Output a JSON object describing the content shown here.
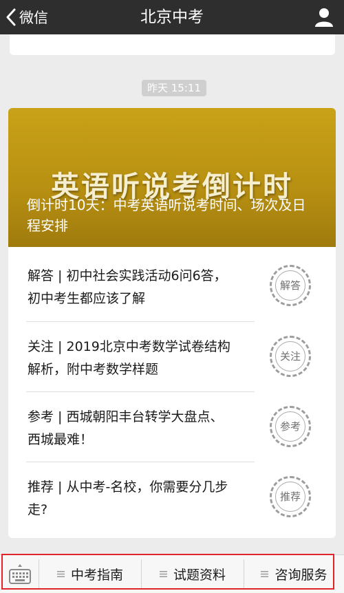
{
  "header": {
    "back_label": "微信",
    "title": "北京中考"
  },
  "timestamp": "昨天 15:11",
  "article": {
    "banner_text": "英语听说考倒计时",
    "title": "倒计时10天：中考英语听说考时间、场次及日程安排",
    "items": [
      {
        "text": "解答 | 初中社会实践活动6问6答，初中考生都应该了解",
        "stamp": "解答"
      },
      {
        "text": "关注 | 2019北京中考数学试卷结构解析，附中考数学样题",
        "stamp": "关注"
      },
      {
        "text": "参考 | 西城朝阳丰台转学大盘点、西城最难！",
        "stamp": "参考"
      },
      {
        "text": "推荐 | 从中考-名校，你需要分几步走?",
        "stamp": "推荐"
      }
    ]
  },
  "menu": {
    "items": [
      "中考指南",
      "试题资料",
      "咨询服务"
    ]
  },
  "colors": {
    "header_bg": "#2e2e2e",
    "hero_gold": "#b99112",
    "highlight": "#e2242a"
  }
}
